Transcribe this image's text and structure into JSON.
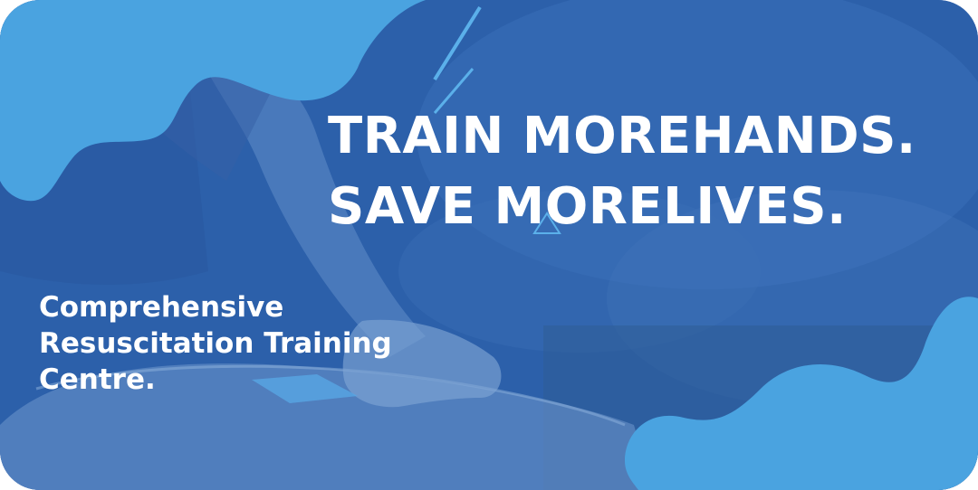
{
  "headline": {
    "line1": "TRAIN MOREHANDS.",
    "line2": "SAVE MORELIVES."
  },
  "tagline": {
    "line1": "Comprehensive",
    "line2": "Resuscitation Training",
    "line3": "Centre."
  },
  "colors": {
    "overlay_blue": "#2b5ea8",
    "wave_light_blue": "#4aa3e0",
    "text": "#ffffff"
  }
}
